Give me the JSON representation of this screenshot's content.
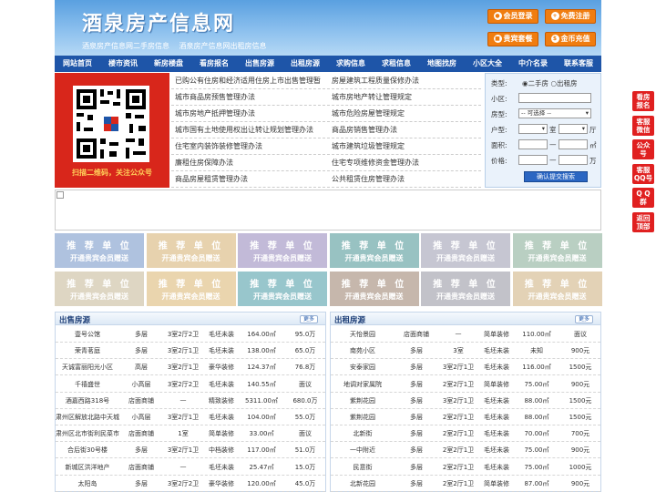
{
  "header": {
    "logo": "酒泉房产信息网",
    "tagline": [
      "酒泉房产信息网二手房信息",
      "酒泉房产信息网出租房信息"
    ],
    "buttons": [
      "会员登录",
      "免费注册",
      "贵宾套餐",
      "金币充值"
    ]
  },
  "nav": [
    "网站首页",
    "楼市资讯",
    "新房楼盘",
    "看房报名",
    "出售房源",
    "出租房源",
    "求购信息",
    "求租信息",
    "地图找房",
    "小区大全",
    "中介名录",
    "联系客服"
  ],
  "qr": {
    "caption": "扫描二维码，关注公众号"
  },
  "links": [
    [
      "已购公有住房和经济适用住房上市出售管理暂",
      "房屋建筑工程质量保修办法"
    ],
    [
      "城市商品房预售管理办法",
      "城市房地产转让管理规定"
    ],
    [
      "城市房地产抵押管理办法",
      "城市危险房屋管理规定"
    ],
    [
      "城市国有土地使用权出让转让规划管理办法",
      "商品房销售管理办法"
    ],
    [
      "住宅室内装饰装修管理办法",
      "城市建筑垃圾管理规定"
    ],
    [
      "廉租住房保障办法",
      "住宅专项维修资金管理办法"
    ],
    [
      "商品房屋租赁管理办法",
      "公共租赁住房管理办法"
    ]
  ],
  "search": {
    "type_label": "类型:",
    "opt1": "二手房",
    "opt2": "出租房",
    "estate_label": "小区:",
    "house_label": "房型:",
    "house_value": "-- 可选择 --",
    "layout_label": "户型:",
    "room_unit": "室",
    "hall_unit": "厅",
    "area_label": "面积:",
    "area_sep": "—",
    "area_unit": "㎡",
    "price_label": "价格:",
    "price_sep": "—",
    "price_unit": "万",
    "submit": "确认提交搜索"
  },
  "ads": {
    "line1": "推 荐 单 位",
    "line2": "开通贵宾会员赠送"
  },
  "sale": {
    "title": "出售房源",
    "more": "更多",
    "rows": [
      [
        "壹号公馆",
        "多层",
        "3室2厅2卫",
        "毛坯未装",
        "164.00㎡",
        "95.0万"
      ],
      [
        "荣青茗庭",
        "多层",
        "3室2厅1卫",
        "毛坯未装",
        "138.00㎡",
        "65.0万"
      ],
      [
        "天诚富丽阳光小区",
        "高层",
        "3室2厅1卫",
        "豪华装修",
        "124.37㎡",
        "76.8万"
      ],
      [
        "千禧盛世",
        "小高层",
        "3室2厅2卫",
        "毛坯未装",
        "140.55㎡",
        "面议"
      ],
      [
        "酒嘉西路318号",
        "店面商铺",
        "—",
        "精致装修",
        "5311.00㎡",
        "680.0万"
      ],
      [
        "肃州区解放北路中天城",
        "小高层",
        "3室2厅1卫",
        "毛坯未装",
        "104.00㎡",
        "55.0万"
      ],
      [
        "肃州区北市街利民菜市",
        "店面商铺",
        "1室",
        "简单装修",
        "33.00㎡",
        "面议"
      ],
      [
        "合后街30号楼",
        "多层",
        "3室2厅1卫",
        "中档装修",
        "117.00㎡",
        "51.0万"
      ],
      [
        "新城区洪洋地产",
        "店面商铺",
        "—",
        "毛坯未装",
        "25.47㎡",
        "15.0万"
      ],
      [
        "太阳岛",
        "多层",
        "3室2厅2卫",
        "豪华装修",
        "120.00㎡",
        "45.0万"
      ]
    ]
  },
  "rent": {
    "title": "出租房源",
    "more": "更多",
    "rows": [
      [
        "天怡景园",
        "店面商铺",
        "—",
        "简单装修",
        "110.00㎡",
        "面议"
      ],
      [
        "南苑小区",
        "多层",
        "3室",
        "毛坯未装",
        "未知",
        "900元"
      ],
      [
        "安泰家园",
        "多层",
        "3室2厅1卫",
        "毛坯未装",
        "116.00㎡",
        "1500元"
      ],
      [
        "地调对家属院",
        "多层",
        "2室2厅1卫",
        "简单装修",
        "75.00㎡",
        "900元"
      ],
      [
        "紫荆花园",
        "多层",
        "3室2厅1卫",
        "毛坯未装",
        "88.00㎡",
        "1500元"
      ],
      [
        "紫荆花园",
        "多层",
        "2室2厅1卫",
        "毛坯未装",
        "88.00㎡",
        "1500元"
      ],
      [
        "北新街",
        "多层",
        "2室2厅1卫",
        "毛坯未装",
        "70.00㎡",
        "700元"
      ],
      [
        "一中附近",
        "多层",
        "2室2厅1卫",
        "毛坯未装",
        "75.00㎡",
        "900元"
      ],
      [
        "民意街",
        "多层",
        "2室2厅1卫",
        "毛坯未装",
        "75.00㎡",
        "1000元"
      ],
      [
        "北新花园",
        "多层",
        "2室2厅1卫",
        "简单装修",
        "87.00㎡",
        "900元"
      ]
    ]
  },
  "side": [
    [
      "看房",
      "报名"
    ],
    [
      "客服",
      "微信"
    ],
    [
      "公众",
      "号"
    ],
    [
      "客服",
      "QQ号"
    ],
    [
      "Q Q",
      "群"
    ],
    [
      "返回",
      "顶部"
    ]
  ],
  "colors": {
    "nav": "#1e55a8",
    "orange": "#f07d10",
    "side": "#e02020",
    "qr_bg": "#d8261b"
  }
}
